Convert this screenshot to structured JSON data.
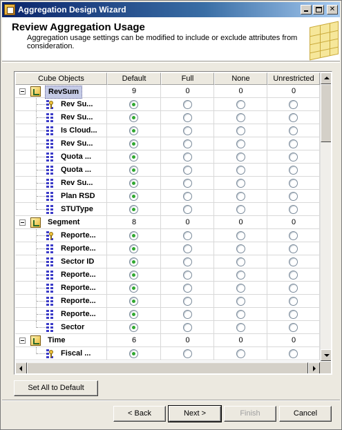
{
  "window": {
    "title": "Aggregation Design Wizard"
  },
  "header": {
    "title": "Review Aggregation Usage",
    "description": "Aggregation usage settings can be modified to include or exclude attributes from consideration."
  },
  "grid": {
    "columns": [
      "Cube Objects",
      "Default",
      "Full",
      "None",
      "Unrestricted"
    ],
    "rows": [
      {
        "kind": "cube",
        "name": "RevSum",
        "default": "9",
        "full": "0",
        "none": "0",
        "unrestricted": "0",
        "selected": true
      },
      {
        "kind": "attr",
        "icon": "key-icon",
        "name": "Rev Su...",
        "selected_col": "default"
      },
      {
        "kind": "attr",
        "icon": "attribute-icon",
        "name": "Rev Su...",
        "selected_col": "default"
      },
      {
        "kind": "attr",
        "icon": "attribute-icon",
        "name": "Is Cloud...",
        "selected_col": "default"
      },
      {
        "kind": "attr",
        "icon": "attribute-icon",
        "name": "Rev Su...",
        "selected_col": "default"
      },
      {
        "kind": "attr",
        "icon": "attribute-icon",
        "name": "Quota ...",
        "selected_col": "default"
      },
      {
        "kind": "attr",
        "icon": "attribute-icon",
        "name": "Quota ...",
        "selected_col": "default"
      },
      {
        "kind": "attr",
        "icon": "attribute-icon",
        "name": "Rev Su...",
        "selected_col": "default"
      },
      {
        "kind": "attr",
        "icon": "attribute-icon",
        "name": "Plan RSD",
        "selected_col": "default"
      },
      {
        "kind": "attr",
        "icon": "attribute-icon",
        "name": "STUType",
        "selected_col": "default"
      },
      {
        "kind": "cube",
        "name": "Segment",
        "default": "8",
        "full": "0",
        "none": "0",
        "unrestricted": "0",
        "selected": false
      },
      {
        "kind": "attr",
        "icon": "key-icon",
        "name": "Reporte...",
        "selected_col": "default"
      },
      {
        "kind": "attr",
        "icon": "attribute-icon",
        "name": "Reporte...",
        "selected_col": "default"
      },
      {
        "kind": "attr",
        "icon": "attribute-icon",
        "name": "Sector ID",
        "selected_col": "default"
      },
      {
        "kind": "attr",
        "icon": "attribute-icon",
        "name": "Reporte...",
        "selected_col": "default"
      },
      {
        "kind": "attr",
        "icon": "attribute-icon",
        "name": "Reporte...",
        "selected_col": "default"
      },
      {
        "kind": "attr",
        "icon": "attribute-icon",
        "name": "Reporte...",
        "selected_col": "default"
      },
      {
        "kind": "attr",
        "icon": "attribute-icon",
        "name": "Reporte...",
        "selected_col": "default"
      },
      {
        "kind": "attr",
        "icon": "attribute-icon",
        "name": "Sector",
        "selected_col": "default"
      },
      {
        "kind": "cube",
        "name": "Time",
        "default": "6",
        "full": "0",
        "none": "0",
        "unrestricted": "0",
        "selected": false
      },
      {
        "kind": "attr",
        "icon": "key-icon",
        "name": "Fiscal ...",
        "selected_col": "default"
      }
    ]
  },
  "buttons": {
    "set_all_default": "Set All to Default",
    "back": "< Back",
    "next": "Next >",
    "finish": "Finish",
    "cancel": "Cancel"
  },
  "colors": {
    "selected_radio": "#2fa82f",
    "selection_highlight": "#c5cbe6"
  }
}
